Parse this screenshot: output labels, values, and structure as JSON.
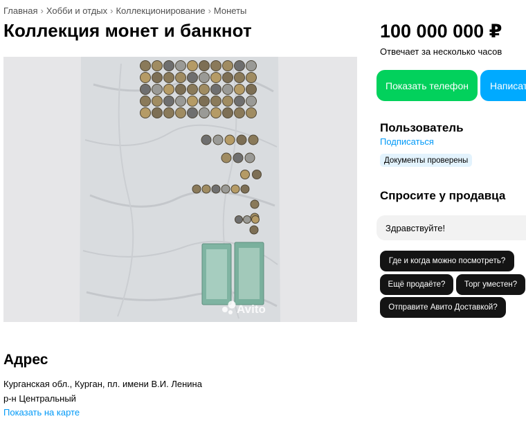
{
  "breadcrumb": {
    "items": [
      "Главная",
      "Хобби и отдых",
      "Коллекционирование",
      "Монеты"
    ],
    "separator": "›"
  },
  "listing": {
    "title": "Коллекция монет и банкнот",
    "photo_watermark": "Avito"
  },
  "sidebar": {
    "price": "100 000 000 ₽",
    "reply_time": "Отвечает за несколько часов",
    "show_phone_label": "Показать телефон",
    "write_label": "Написать",
    "seller_name": "Пользователь",
    "subscribe_label": "Подписаться",
    "docs_badge": "Документы проверены",
    "ask_title": "Спросите у продавца",
    "message_value": "Здравствуйте!",
    "quick_questions": [
      "Где и когда можно посмотреть?",
      "Ещё продаёте?",
      "Торг уместен?",
      "Отправите Авито Доставкой?"
    ]
  },
  "address": {
    "title": "Адрес",
    "line1": "Курганская обл., Курган, пл. имени В.И. Ленина",
    "line2": "р-н Центральный",
    "map_link": "Показать на карте"
  },
  "colors": {
    "green_button": "#02d15c",
    "blue_button": "#00aaff",
    "link": "#0099f7",
    "chip": "#141414",
    "badge": "#e3f3fd"
  }
}
